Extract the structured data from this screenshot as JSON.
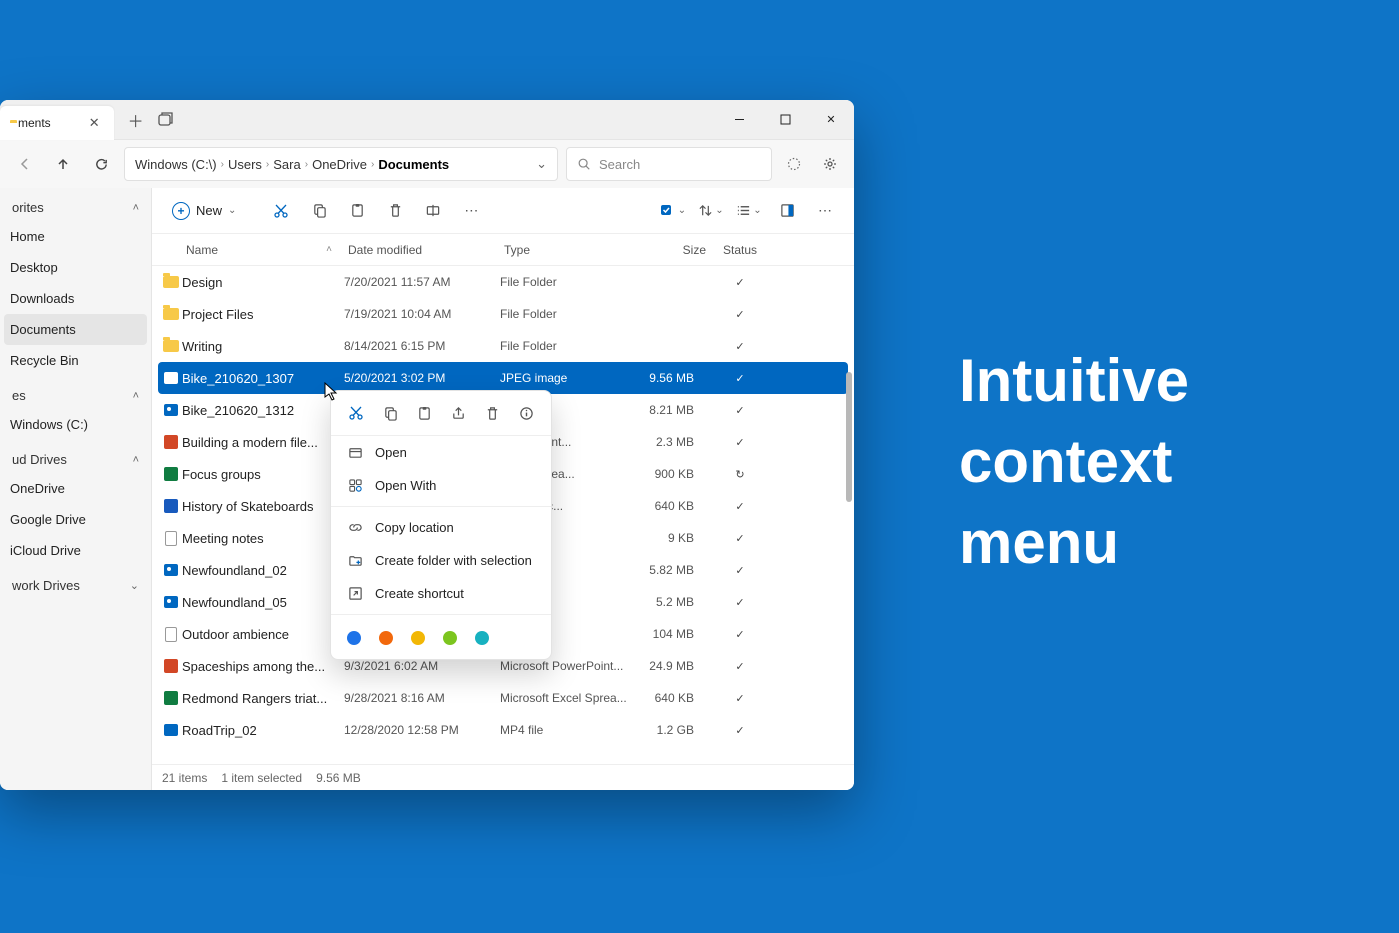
{
  "promo": {
    "line1": "Intuitive",
    "line2": "context",
    "line3": "menu"
  },
  "tab": {
    "title": "ments"
  },
  "breadcrumb": [
    "Windows (C:\\)",
    "Users",
    "Sara",
    "OneDrive",
    "Documents"
  ],
  "search": {
    "placeholder": "Search"
  },
  "toolbar": {
    "new": "New"
  },
  "sidebar": {
    "groups": [
      {
        "title": "orites",
        "items": [
          "Home",
          "Desktop",
          "Downloads",
          "Documents",
          "Recycle Bin"
        ],
        "active": 3
      },
      {
        "title": "es",
        "items": [
          "Windows (C:)"
        ]
      },
      {
        "title": "ud Drives",
        "items": [
          "OneDrive",
          "Google Drive",
          "iCloud Drive"
        ]
      },
      {
        "title": "work Drives",
        "items": []
      }
    ]
  },
  "columns": {
    "name": "Name",
    "date": "Date modified",
    "type": "Type",
    "size": "Size",
    "status": "Status"
  },
  "rows": [
    {
      "icon": "folder",
      "name": "Design",
      "date": "7/20/2021  11:57 AM",
      "type": "File Folder",
      "size": "",
      "status": "✓"
    },
    {
      "icon": "folder",
      "name": "Project Files",
      "date": "7/19/2021  10:04 AM",
      "type": "File Folder",
      "size": "",
      "status": "✓"
    },
    {
      "icon": "folder",
      "name": "Writing",
      "date": "8/14/2021  6:15 PM",
      "type": "File Folder",
      "size": "",
      "status": "✓"
    },
    {
      "icon": "img",
      "name": "Bike_210620_1307",
      "date": "5/20/2021  3:02 PM",
      "type": "JPEG image",
      "size": "9.56 MB",
      "status": "✓",
      "selected": true
    },
    {
      "icon": "img",
      "name": "Bike_210620_1312",
      "date": "",
      "type": "e",
      "size": "8.21 MB",
      "status": "✓"
    },
    {
      "icon": "ppt",
      "name": "Building a modern file...",
      "date": "",
      "type": "PowerPoint...",
      "size": "2.3 MB",
      "status": "✓"
    },
    {
      "icon": "xls",
      "name": "Focus groups",
      "date": "",
      "type": "Excel Sprea...",
      "size": "900 KB",
      "status": "↻"
    },
    {
      "icon": "doc",
      "name": "History of Skateboards",
      "date": "",
      "type": "Word Doc...",
      "size": "640 KB",
      "status": "✓"
    },
    {
      "icon": "file",
      "name": "Meeting notes",
      "date": "",
      "type": "ment",
      "size": "9 KB",
      "status": "✓"
    },
    {
      "icon": "img",
      "name": "Newfoundland_02",
      "date": "",
      "type": "e",
      "size": "5.82 MB",
      "status": "✓"
    },
    {
      "icon": "img",
      "name": "Newfoundland_05",
      "date": "",
      "type": "e",
      "size": "5.2 MB",
      "status": "✓"
    },
    {
      "icon": "file",
      "name": "Outdoor ambience",
      "date": "",
      "type": "",
      "size": "104 MB",
      "status": "✓"
    },
    {
      "icon": "ppt",
      "name": "Spaceships among the...",
      "date": "9/3/2021  6:02 AM",
      "type": "Microsoft PowerPoint...",
      "size": "24.9 MB",
      "status": "✓"
    },
    {
      "icon": "xls",
      "name": "Redmond Rangers triat...",
      "date": "9/28/2021  8:16 AM",
      "type": "Microsoft Excel Sprea...",
      "size": "640 KB",
      "status": "✓"
    },
    {
      "icon": "vid",
      "name": "RoadTrip_02",
      "date": "12/28/2020  12:58 PM",
      "type": "MP4 file",
      "size": "1.2 GB",
      "status": "✓"
    }
  ],
  "context_menu": {
    "items": [
      {
        "icon": "open",
        "label": "Open"
      },
      {
        "icon": "openwith",
        "label": "Open With"
      },
      {
        "sep": true
      },
      {
        "icon": "link",
        "label": "Copy location"
      },
      {
        "icon": "newfolder",
        "label": "Create folder with selection"
      },
      {
        "icon": "shortcut",
        "label": "Create shortcut"
      }
    ],
    "tags": [
      "#1e73e8",
      "#f2680c",
      "#f2b705",
      "#7cc51f",
      "#17b1c0"
    ]
  },
  "statusbar": {
    "count": "21 items",
    "selected": "1 item selected",
    "size": "9.56 MB"
  }
}
